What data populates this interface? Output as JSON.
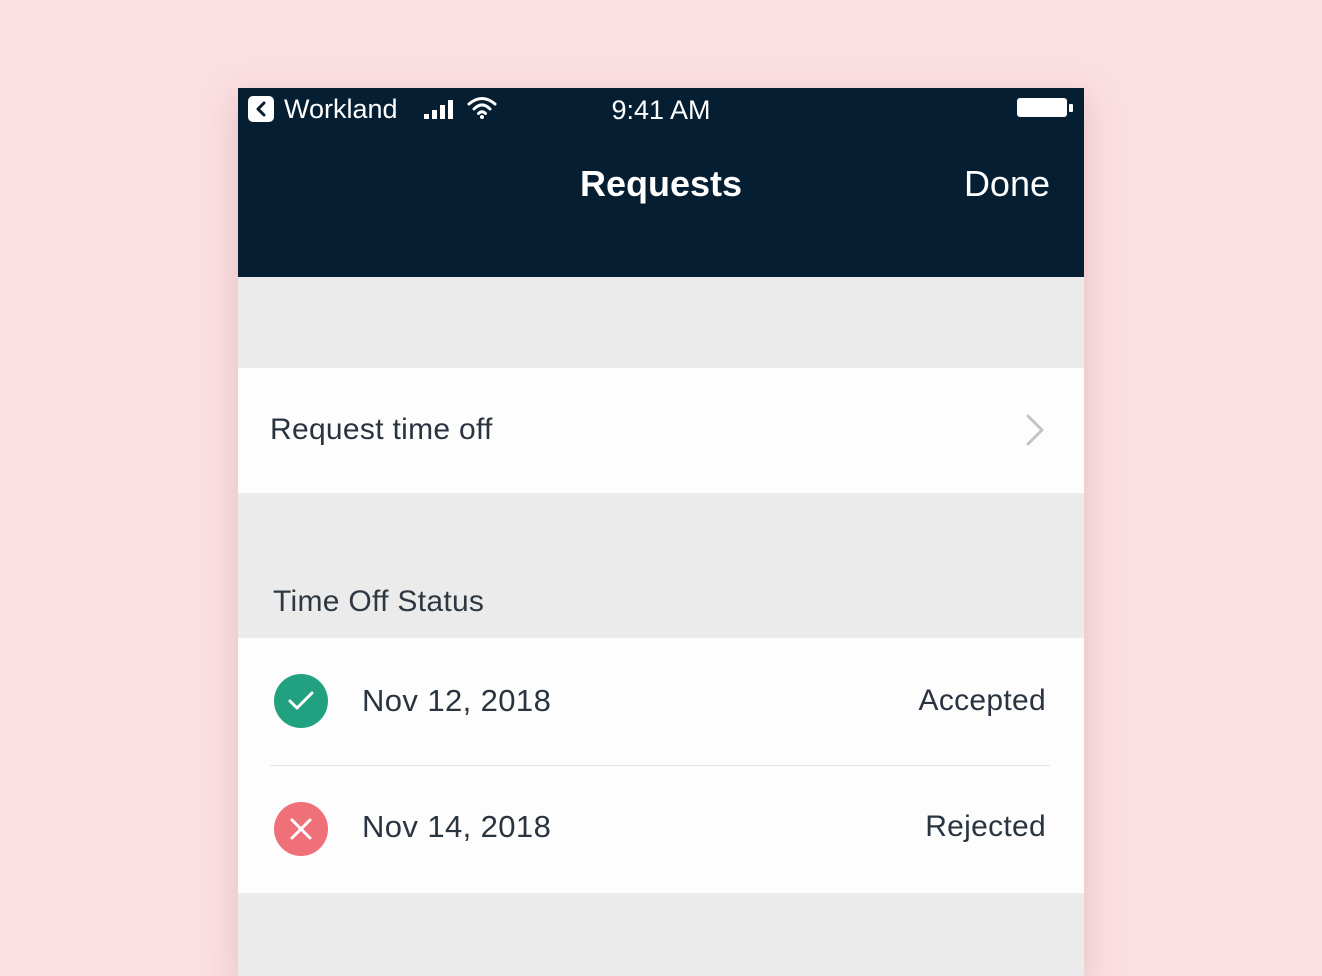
{
  "status_bar": {
    "back_app_label": "Workland",
    "time": "9:41 AM",
    "icons": [
      "back-arrow-icon",
      "signal-icon",
      "wifi-icon",
      "battery-icon"
    ]
  },
  "navbar": {
    "title": "Requests",
    "done_label": "Done"
  },
  "request_cell": {
    "label": "Request time off",
    "icon": "chevron-right-icon"
  },
  "time_off_section": {
    "header": "Time Off Status",
    "rows": [
      {
        "date": "Nov 12, 2018",
        "status": "Accepted",
        "icon": "check-icon"
      },
      {
        "date": "Nov 14, 2018",
        "status": "Rejected",
        "icon": "x-icon"
      }
    ]
  },
  "colors": {
    "page_background": "#fbdfe2",
    "navbar": "#061e32",
    "grouped_background": "#ebebeb",
    "cell_background": "#fdfdfd",
    "accepted": "#21a17f",
    "rejected": "#f0707a",
    "text": "#2a3440"
  }
}
